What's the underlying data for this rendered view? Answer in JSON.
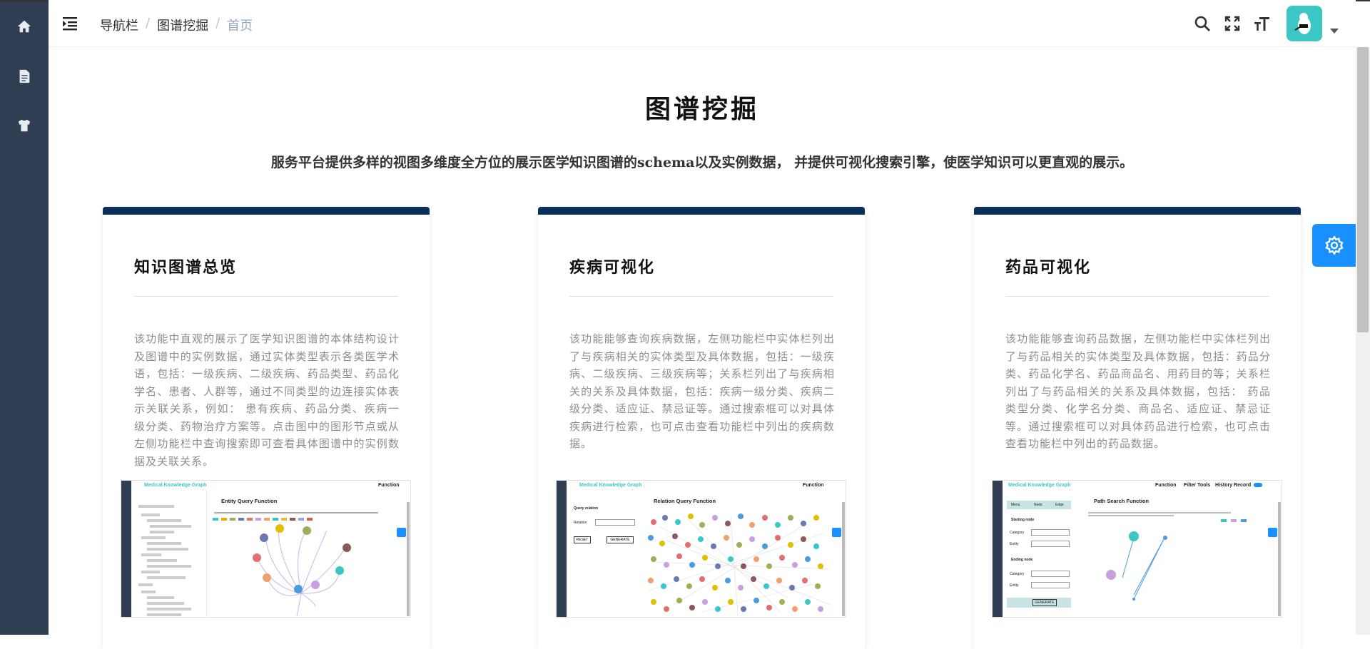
{
  "sidebar": {
    "items": [
      {
        "icon": "home-icon"
      },
      {
        "icon": "document-icon"
      },
      {
        "icon": "shirt-icon"
      }
    ]
  },
  "header": {
    "breadcrumb": [
      "导航栏",
      "图谱挖掘",
      "首页"
    ],
    "icons": [
      "search-icon",
      "fullscreen-icon",
      "font-size-icon"
    ]
  },
  "main": {
    "title": "图谱挖掘",
    "description": "服务平台提供多样的视图多维度全方位的展示医学知识图谱的schema以及实例数据， 并提供可视化搜索引擎，使医学知识可以更直观的展示。",
    "cards": [
      {
        "title": "知识图谱总览",
        "text": "该功能中直观的展示了医学知识图谱的本体结构设计及图谱中的实例数据，通过实体类型表示各类医学术语，包括：一级疾病、二级疾病、药品类型、药品化学名、患者、人群等，通过不同类型的边连接实体表示关联关系，例如： 患有疾病、药品分类、疾病一级分类、药物治疗方案等。点击图中的图形节点或从左侧功能栏中查询搜索即可查看具体图谱中的实例数据及关联关系。",
        "shot": {
          "logo": "Medical Knowledge Graph",
          "fn": [
            "Function"
          ],
          "heading": "Entity Query Function"
        }
      },
      {
        "title": "疾病可视化",
        "text": "该功能能够查询疾病数据，左侧功能栏中实体栏列出了与疾病相关的实体类型及具体数据，包括：一级疾病、二级疾病、三级疾病等；关系栏列出了与疾病相关的关系及具体数据，包括：疾病一级分类、疾病二级分类、适应证、禁忌证等。通过搜索框可以对具体疾病进行检索，也可点击查看功能栏中列出的疾病数据。",
        "shot": {
          "logo": "Medical Knowledge Graph",
          "fn": [
            "Function"
          ],
          "heading": "Relation Query Function",
          "query": "Query relation",
          "relation": "Relation",
          "reset": "RESET",
          "generate": "GENERATE"
        }
      },
      {
        "title": "药品可视化",
        "text": "该功能能够查询药品数据，左侧功能栏中实体栏列出了与药品相关的实体类型及具体数据，包括：药品分类、药品化学名、药品商品名、用药目的等；关系栏列出了与药品相关的关系及具体数据，包括： 药品类型分类、化学名分类、商品名、适应证、禁忌证等。通过搜索框可以对具体药品进行检索，也可点击查看功能栏中列出的药品数据。",
        "shot": {
          "logo": "Medical Knowledge Graph",
          "fn": [
            "Function",
            "Filter Tools",
            "History Record"
          ],
          "heading": "Path Search Function",
          "tabs": [
            "Menu",
            "Node",
            "Edge"
          ],
          "start": "Starting node",
          "end": "Ending node",
          "category": "Category",
          "entity": "Entity",
          "generate": "GENERATE"
        }
      }
    ]
  },
  "colors": {
    "sidebar": "#2f3e52",
    "card_top": "#0b2f5b",
    "accent": "#1890ff",
    "avatar": "#3cc6c6"
  }
}
